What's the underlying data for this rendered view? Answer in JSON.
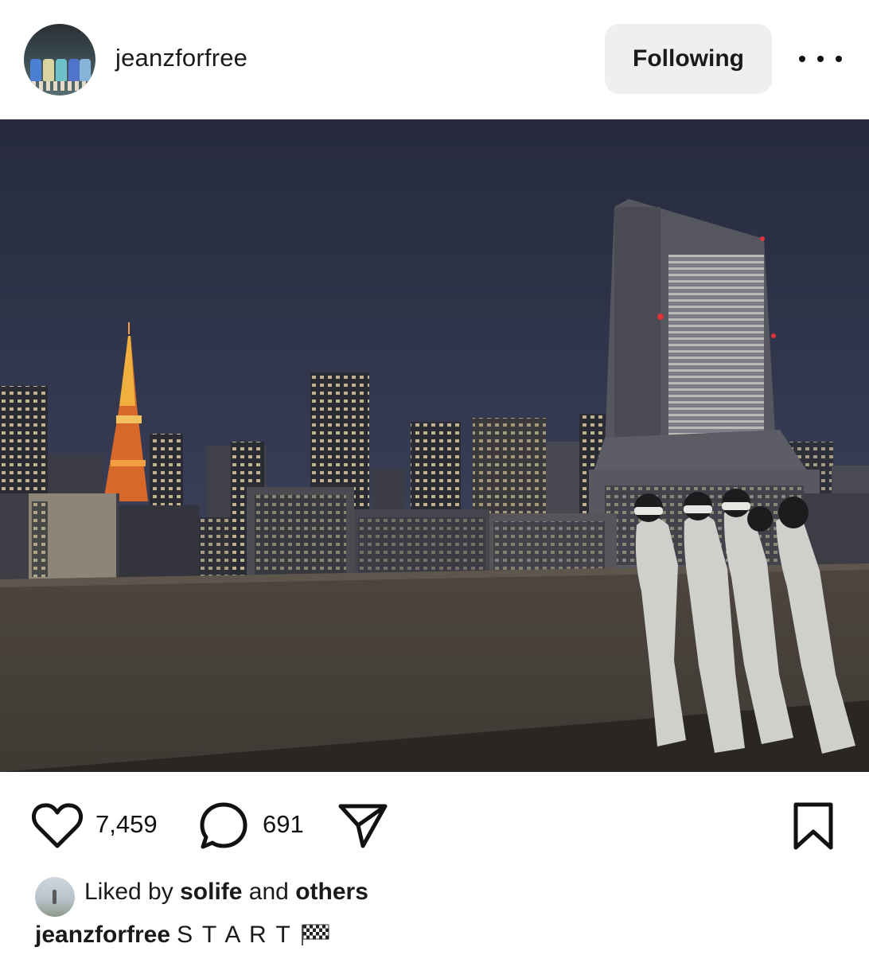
{
  "post": {
    "username": "jeanzforfree",
    "follow_label": "Following",
    "more_icon": "more-horizontal-icon",
    "image_alt": "Night city skyline with Tokyo Tower and people in white on a rooftop"
  },
  "actions": {
    "like_icon": "heart-icon",
    "like_count": "7,459",
    "comment_icon": "comment-bubble-icon",
    "comment_count": "691",
    "share_icon": "paper-plane-icon",
    "save_icon": "bookmark-icon"
  },
  "liked_by": {
    "prefix": "Liked by",
    "user": "solife",
    "connector": "and",
    "others": "others"
  },
  "caption": {
    "username": "jeanzforfree",
    "text": "S T A R T",
    "emoji_icon": "checkered-flag-icon"
  },
  "colors": {
    "button_bg": "#efefef",
    "text": "#111111",
    "sky": "#2f3448",
    "tower": "#e0702a"
  }
}
